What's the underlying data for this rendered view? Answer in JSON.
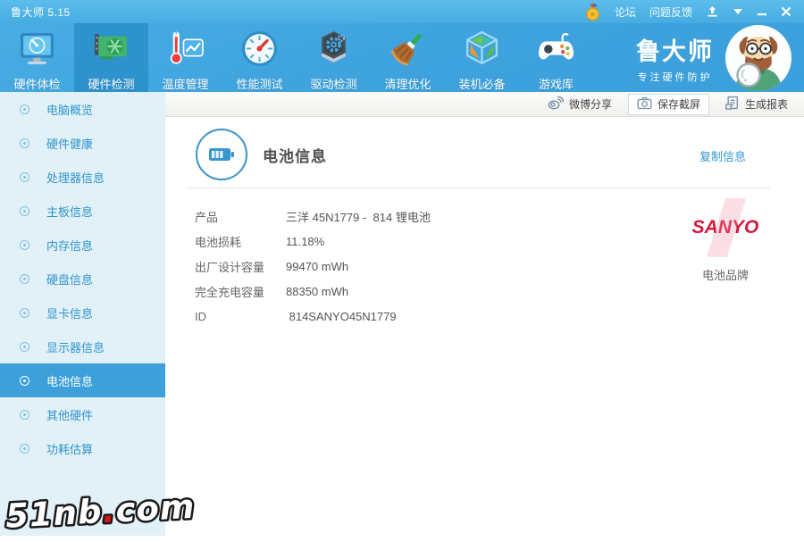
{
  "titlebar": {
    "title": "鲁大师 5.15",
    "forum": "论坛",
    "feedback": "问题反馈"
  },
  "nav": {
    "brand": {
      "name": "鲁大师",
      "slogan": "专注硬件防护"
    },
    "tabs": [
      {
        "label": "硬件体检",
        "icon": "monitor-radar-icon"
      },
      {
        "label": "硬件检测",
        "icon": "gpu-card-icon"
      },
      {
        "label": "温度管理",
        "icon": "thermometer-chart-icon"
      },
      {
        "label": "性能测试",
        "icon": "speed-gauge-icon"
      },
      {
        "label": "驱动检测",
        "icon": "gear-hexagon-icon"
      },
      {
        "label": "清理优化",
        "icon": "broom-icon"
      },
      {
        "label": "装机必备",
        "icon": "software-cube-icon"
      },
      {
        "label": "游戏库",
        "icon": "gamepad-icon"
      }
    ]
  },
  "toolbar": {
    "weibo_share": "微博分享",
    "save_screenshot": "保存截屏",
    "generate_report": "生成报表"
  },
  "sidebar": {
    "items": [
      {
        "label": "电脑概览",
        "active": false
      },
      {
        "label": "硬件健康",
        "active": false
      },
      {
        "label": "处理器信息",
        "active": false
      },
      {
        "label": "主板信息",
        "active": false
      },
      {
        "label": "内存信息",
        "active": false
      },
      {
        "label": "硬盘信息",
        "active": false
      },
      {
        "label": "显卡信息",
        "active": false
      },
      {
        "label": "显示器信息",
        "active": false
      },
      {
        "label": "电池信息",
        "active": true
      },
      {
        "label": "其他硬件",
        "active": false
      },
      {
        "label": "功耗估算",
        "active": false
      }
    ]
  },
  "content": {
    "title": "电池信息",
    "copy_link": "复制信息",
    "rows": [
      {
        "label": "产品",
        "value": "三洋 45N1779 -  814 锂电池"
      },
      {
        "label": "电池损耗",
        "value": "11.18%"
      },
      {
        "label": "出厂设计容量",
        "value": "99470 mWh"
      },
      {
        "label": "完全充电容量",
        "value": "88350 mWh"
      },
      {
        "label": "ID",
        "value": " 814SANYO45N1779"
      }
    ],
    "battery_brand": {
      "logo_text": "SANYO",
      "caption": "电池品牌"
    }
  },
  "watermark": {
    "part1": "51nb",
    "dot": ".",
    "part2": "com"
  },
  "colors": {
    "accent_blue": "#3da1dc",
    "active_tab_blue": "#2e92cc",
    "sidebar_bg": "#e2f0f8",
    "sidebar_selected": "#3da0da",
    "link_blue": "#3399cc",
    "sanyo_red": "#d6173d"
  }
}
